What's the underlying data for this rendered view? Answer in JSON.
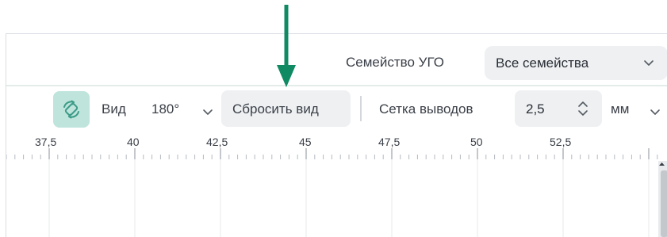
{
  "toolbar_top": {
    "family_label": "Семейство УГО",
    "family_select_value": "Все семейства"
  },
  "toolbar_view": {
    "view_label": "Вид",
    "angle_value": "180°",
    "reset_button_label": "Сбросить вид",
    "grid_label": "Сетка выводов",
    "grid_value": "2,5",
    "unit_value": "мм"
  },
  "ruler": {
    "labels": [
      "37,5",
      "40",
      "42,5",
      "45",
      "47,5",
      "50",
      "52,5"
    ]
  },
  "annotation": {
    "arrow_color": "#0f8a63"
  },
  "colors": {
    "accent_button_bg": "#bfe4dc",
    "rotate_icon": "#3b9b87",
    "control_bg": "#eef0f2"
  }
}
